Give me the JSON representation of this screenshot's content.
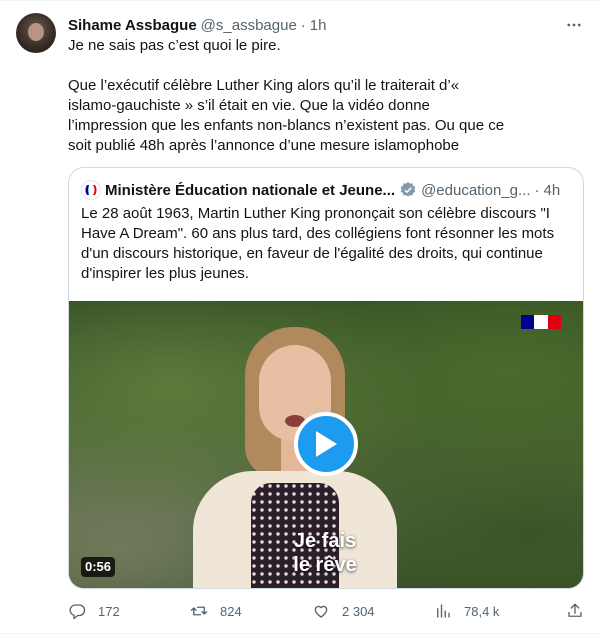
{
  "tweet": {
    "author_name": "Sihame Assbague",
    "author_handle": "@s_assbague",
    "separator": "·",
    "time": "1h",
    "paragraphs": [
      "Je ne sais pas c’est quoi le pire.",
      "Que l’exécutif célèbre Luther King alors qu’il le traiterait d’« islamo-gauchiste » s’il était en vie. Que la vidéo donne l’impression que les enfants non-blancs n’existent pas. Ou que ce soit publié 48h après l’annonce d’une mesure islamophobe"
    ]
  },
  "quote": {
    "author_name": "Ministère Éducation nationale et Jeune...",
    "author_handle": "@education_g...",
    "separator": "·",
    "time": "4h",
    "text": "Le 28 août 1963, Martin Luther King prononçait son célèbre discours \"I Have A Dream\". 60 ans plus tard, des collégiens font résonner les mots d'un discours historique, en faveur de l'égalité des droits, qui continue d'inspirer les plus jeunes.",
    "video": {
      "subtitle_line1": "Je fais",
      "subtitle_line2": "le rêve",
      "duration": "0:56"
    }
  },
  "actions": {
    "replies": "172",
    "reposts": "824",
    "likes": "2 304",
    "views": "78,4 k"
  },
  "icons": [
    "more-icon",
    "verified-icon",
    "play-icon",
    "reply-icon",
    "repost-icon",
    "like-icon",
    "views-icon",
    "share-icon",
    "republique-francaise-logo"
  ],
  "colors": {
    "accent": "#1d9bf0",
    "text": "#0f1419",
    "muted": "#536471",
    "border": "#cfd9de",
    "verified": "#829aab",
    "flag_blue": "#000091",
    "flag_red": "#e1000f"
  }
}
